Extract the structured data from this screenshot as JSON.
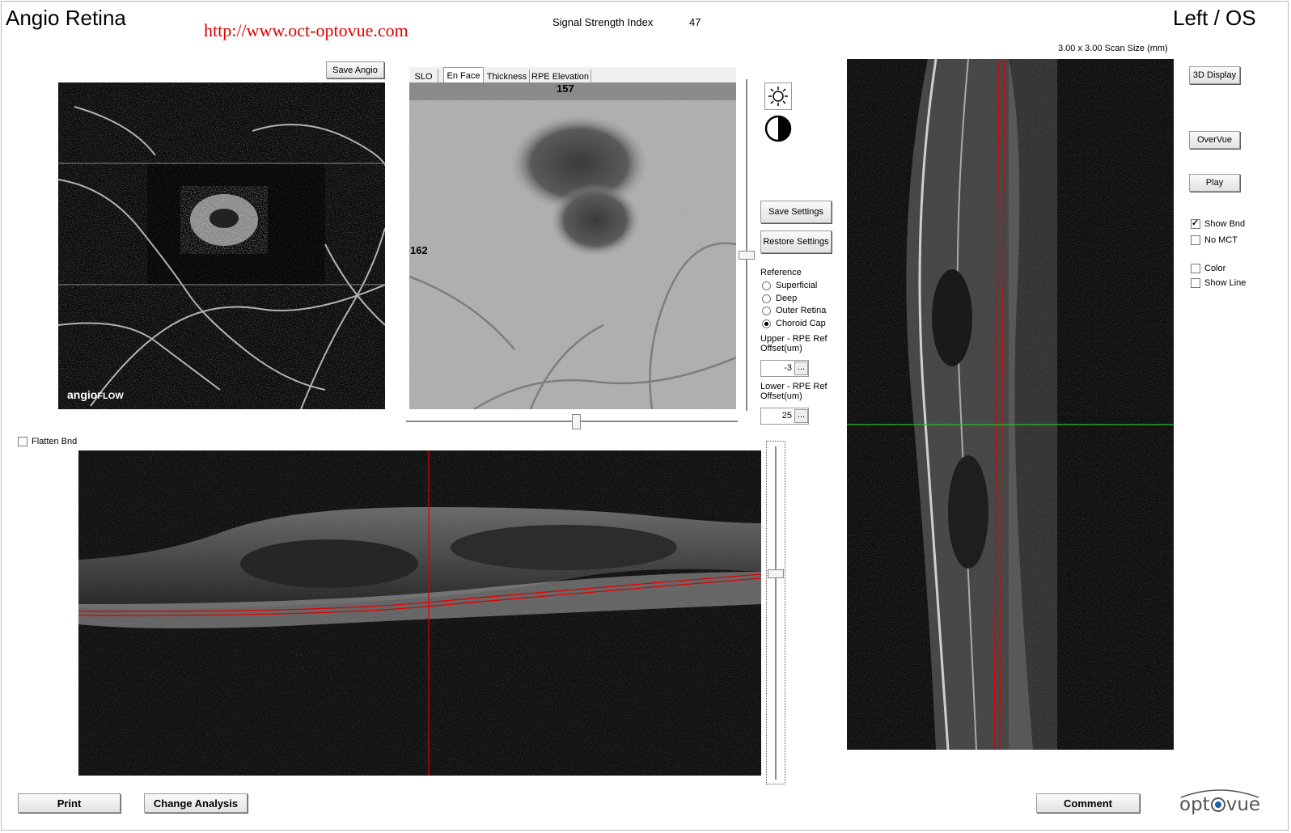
{
  "header": {
    "title": "Angio Retina",
    "url_watermark": "http://www.oct-optovue.com",
    "signal_strength_label": "Signal Strength Index",
    "signal_strength_value": "47",
    "eye": "Left / OS",
    "scan_size": "3.00 x 3.00 Scan Size (mm)"
  },
  "angio_panel": {
    "save_label": "Save Angio",
    "logo_text": "angio",
    "logo_text_bold": "FLOW"
  },
  "enface_panel": {
    "tabs": [
      {
        "label": "SLO",
        "active": false
      },
      {
        "label": "En Face",
        "active": true
      },
      {
        "label": "Thickness",
        "active": false
      },
      {
        "label": "RPE Elevation",
        "active": false
      }
    ],
    "top_value": "157",
    "left_value": "162"
  },
  "settings": {
    "save_settings_label": "Save Settings",
    "restore_settings_label": "Restore Settings",
    "reference_label": "Reference",
    "references": [
      {
        "label": "Superficial",
        "selected": false
      },
      {
        "label": "Deep",
        "selected": false
      },
      {
        "label": "Outer Retina",
        "selected": false
      },
      {
        "label": "Choroid Cap",
        "selected": true
      }
    ],
    "upper_label_1": "Upper - RPE Ref",
    "upper_label_2": "Offset(um)",
    "upper_value": "-3",
    "lower_label_1": "Lower - RPE Ref",
    "lower_label_2": "Offset(um)",
    "lower_value": "25",
    "ellipsis": "..."
  },
  "right_controls": {
    "display3d_label": "3D Display",
    "overvue_label": "OverVue",
    "play_label": "Play",
    "checkboxes": [
      {
        "label": "Show Bnd",
        "checked": true
      },
      {
        "label": "No MCT",
        "checked": false
      },
      {
        "label": "Color",
        "checked": false
      },
      {
        "label": "Show Line",
        "checked": false
      }
    ]
  },
  "bscan": {
    "flatten_label": "Flatten Bnd",
    "flatten_checked": false
  },
  "footer": {
    "print_label": "Print",
    "change_analysis_label": "Change Analysis",
    "comment_label": "Comment",
    "logo_left": "opt",
    "logo_right": "vue"
  },
  "colors": {
    "url": "#e00000",
    "boundary_line": "#e00000",
    "crosshair_green": "#22c322",
    "logo_blue": "#1a5fa8"
  }
}
